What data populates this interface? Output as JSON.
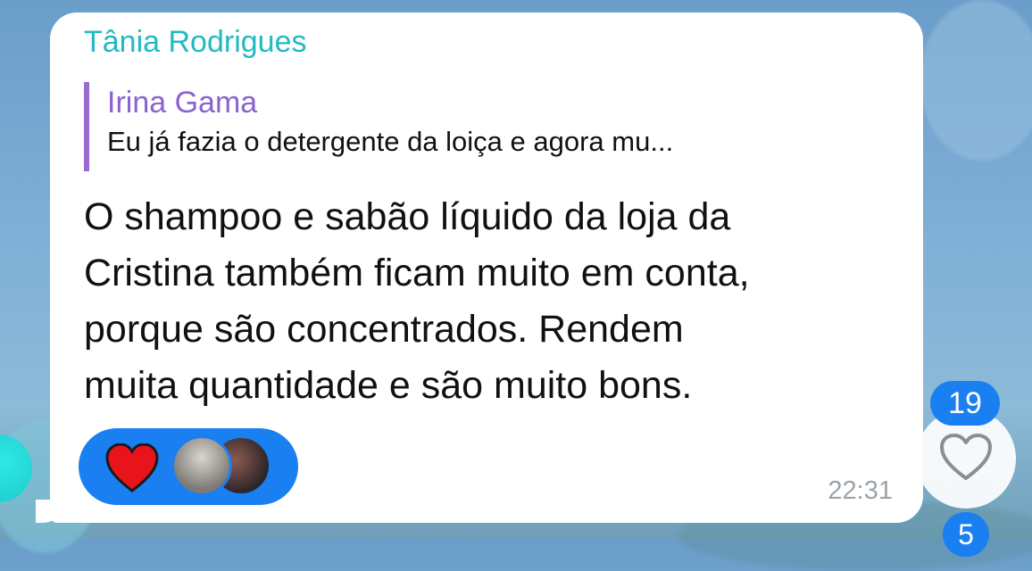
{
  "message": {
    "sender": "Tânia Rodrigues",
    "reply": {
      "author": "Irina Gama",
      "snippet": "Eu já fazia o detergente da loiça e agora mu..."
    },
    "lines": [
      "O shampoo e sabão líquido da loja da",
      "Cristina também ficam muito em conta,",
      "porque são concentrados. Rendem",
      "muita quantidade e são muito bons."
    ],
    "time": "22:31",
    "reactions": {
      "emoji_icon": "red-heart-icon",
      "reactor_avatars": 2
    }
  },
  "side": {
    "unread_badge": "19",
    "like_icon": "heart-outline-icon",
    "bottom_badge": "5"
  },
  "colors": {
    "sender": "#23b9c2",
    "reply_accent": "#8b62cf",
    "accent_blue": "#1a7ff0"
  }
}
